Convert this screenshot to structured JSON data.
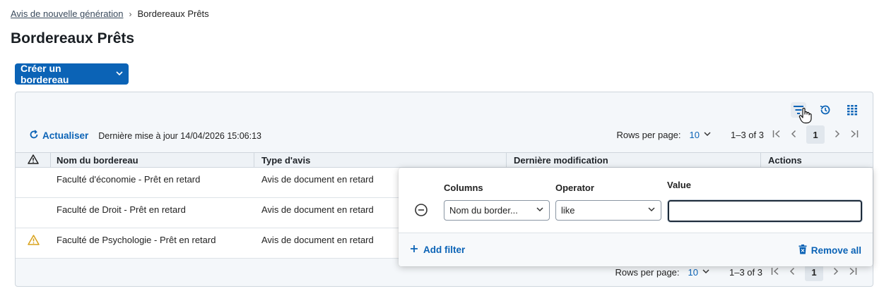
{
  "breadcrumb": {
    "parent": "Avis de nouvelle génération",
    "current": "Bordereaux Prêts"
  },
  "page": {
    "title": "Bordereaux Prêts"
  },
  "create_button": {
    "label": "Créer un bordereau"
  },
  "toolbar": {
    "filter_icon": "filter-lines-icon",
    "history_icon": "history-icon",
    "columns_icon": "columns-icon",
    "refresh_label": "Actualiser",
    "last_update": "Dernière mise à jour 14/04/2026 15:06:13"
  },
  "pagination": {
    "rows_per_page_label": "Rows per page:",
    "rows_per_page": "10",
    "range": "1–3 of 3",
    "page": "1"
  },
  "table": {
    "columns": {
      "name": "Nom du bordereau",
      "type": "Type d'avis",
      "modified": "Dernière modification",
      "actions": "Actions"
    },
    "rows": [
      {
        "warning": false,
        "name": "Faculté d'économie - Prêt en retard",
        "type": "Avis de document en retard"
      },
      {
        "warning": false,
        "name": "Faculté de Droit - Prêt en retard",
        "type": "Avis de document en retard"
      },
      {
        "warning": true,
        "name": "Faculté de Psychologie - Prêt en retard",
        "type": "Avis de document en retard"
      }
    ]
  },
  "filter_panel": {
    "columns_label": "Columns",
    "operator_label": "Operator",
    "value_label": "Value",
    "column_value": "Nom du border...",
    "operator_value": "like",
    "value": "",
    "add_filter": "Add filter",
    "remove_all": "Remove all"
  },
  "colors": {
    "accent": "#0b63b6",
    "warning": "#d9a21b"
  }
}
